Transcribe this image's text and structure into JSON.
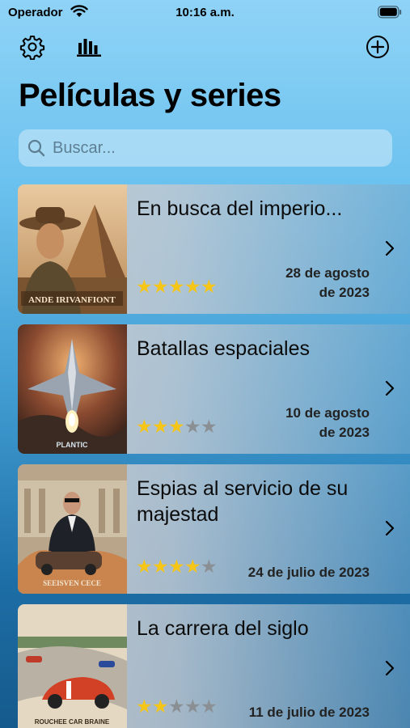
{
  "status": {
    "carrier": "Operador",
    "time": "10:16 a.m."
  },
  "toolbar": {
    "settings": "gear-icon",
    "stats": "chart-bars-icon",
    "add": "plus-circle-icon"
  },
  "title": "Películas y series",
  "search": {
    "placeholder": "Buscar...",
    "value": ""
  },
  "colors": {
    "star_on": "#f5c518",
    "star_off": "#8a8f94"
  },
  "items": [
    {
      "title": "En busca del imperio...",
      "date_line1": "28 de agosto",
      "date_line2": "de 2023",
      "rating": 5,
      "max_rating": 5,
      "poster_text": "ANDE IRIVANFIONT"
    },
    {
      "title": "Batallas espaciales",
      "date_line1": "10 de agosto",
      "date_line2": "de 2023",
      "rating": 3,
      "max_rating": 5,
      "poster_text": "PLANTIC"
    },
    {
      "title": "Espias al servicio de su majestad",
      "date_line1": "",
      "date_line2": "24 de julio de 2023",
      "rating": 4,
      "max_rating": 5,
      "poster_text": "SEEISVEN CECE"
    },
    {
      "title": "La carrera del siglo",
      "date_line1": "",
      "date_line2": "11 de julio de 2023",
      "rating": 2,
      "max_rating": 5,
      "poster_text": "ROUCHEE CAR BRAINE"
    }
  ]
}
